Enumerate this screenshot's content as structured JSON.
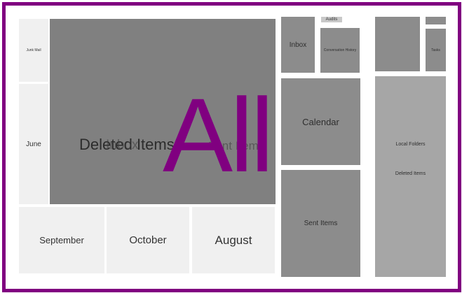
{
  "overlay_text": "All",
  "colors": {
    "frame": "#800080",
    "dark_tile": "#808080",
    "light_tile": "#f0f0f0",
    "side_tile": "#a6a6a6"
  },
  "left_group": {
    "main_label_1": "Deleted Items",
    "main_label_2": "Inbox",
    "main_label_3": "Sent Items",
    "main_label_4": "Calendar",
    "top_left_label": "Junk Mail",
    "june_label": "June",
    "september_label": "September",
    "october_label": "October",
    "august_label": "August"
  },
  "middle_group": {
    "inbox_label": "Inbox",
    "chip_label": "Audits",
    "small_tile_label": "Conversation History",
    "calendar_label": "Calendar",
    "sent_label": "Sent Items"
  },
  "right_group": {
    "small_tile_label": "Tasks",
    "local_folders_label": "Local Folders",
    "deleted_items_label": "Deleted Items"
  }
}
